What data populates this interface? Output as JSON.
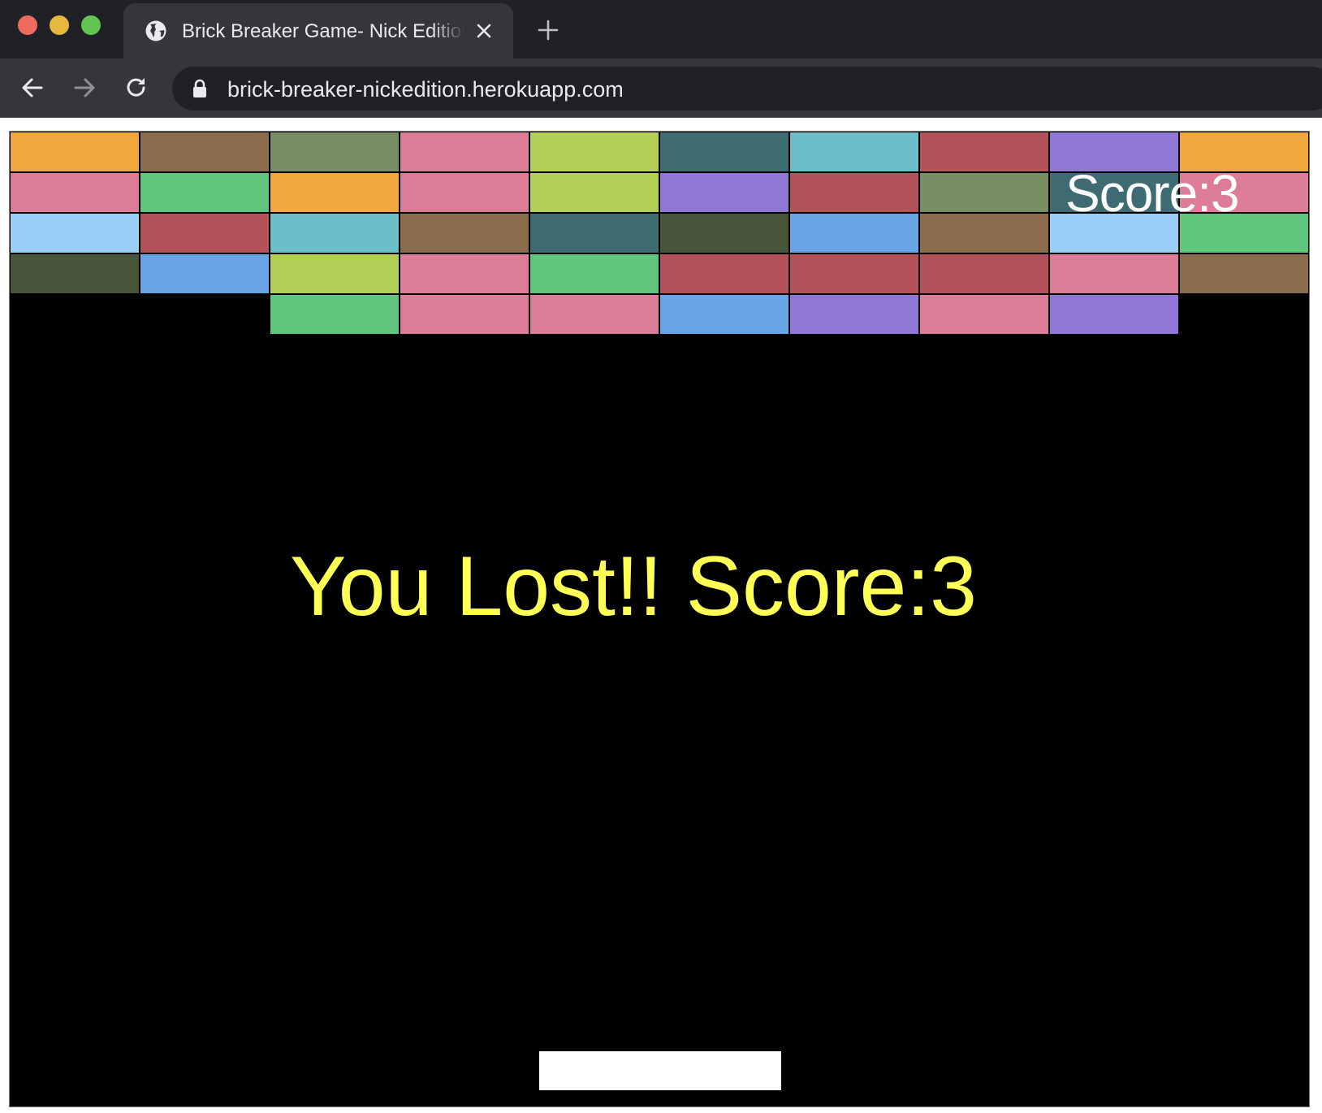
{
  "browser": {
    "tab_title": "Brick Breaker Game- Nick Edition",
    "url": "brick-breaker-nickedition.herokuapp.com",
    "icons": {
      "favicon": "globe-icon",
      "close": "close-icon",
      "new_tab": "plus-icon",
      "back": "back-arrow-icon",
      "forward": "forward-arrow-icon",
      "reload": "reload-icon",
      "lock": "lock-icon"
    }
  },
  "game": {
    "score_hud": "Score:3",
    "message": "You Lost!! Score:3",
    "colors": {
      "background": "#000000",
      "message": "#ffff55",
      "score": "#ffffff",
      "paddle": "#ffffff"
    },
    "brick_grid": {
      "columns": 10,
      "rows": [
        [
          "#f2a73c",
          "#8b6c4c",
          "#788f64",
          "#dc7c96",
          "#b2cf56",
          "#3f6c73",
          "#6cbfc8",
          "#b4525a",
          "#9077d6",
          "#f2a73c"
        ],
        [
          "#dc7c96",
          "#5fc47c",
          "#f2a73c",
          "#dc7c96",
          "#b2cf56",
          "#9077d6",
          "#b4525a",
          "#788f64",
          "#3f6c73",
          "#dc7c96"
        ],
        [
          "#9acef7",
          "#b4525a",
          "#6cbfc8",
          "#8b6c4c",
          "#3f6c73",
          "#47553b",
          "#69a4e6",
          "#8b6c4c",
          "#9acef7",
          "#5fc47c"
        ],
        [
          "#47553b",
          "#69a4e6",
          "#b2cf56",
          "#dc7c96",
          "#5fc47c",
          "#b4525a",
          "#b4525a",
          "#b4525a",
          "#dc7c96",
          "#8b6c4c"
        ],
        [
          null,
          null,
          "#5fc47c",
          "#dc7c96",
          "#dc7c96",
          "#69a4e6",
          "#9077d6",
          "#dc7c96",
          "#9077d6",
          null
        ]
      ]
    }
  }
}
